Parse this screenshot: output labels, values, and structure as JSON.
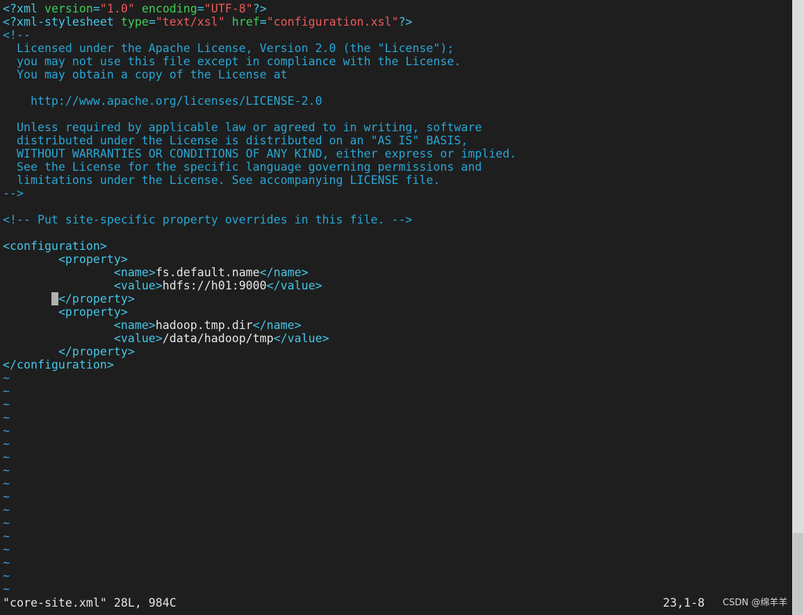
{
  "editor": {
    "lines": [
      [
        {
          "t": "<?",
          "c": "tag"
        },
        {
          "t": "xml ",
          "c": "tag"
        },
        {
          "t": "version",
          "c": "attr"
        },
        {
          "t": "=",
          "c": "tag"
        },
        {
          "t": "\"1.0\"",
          "c": "str"
        },
        {
          "t": " ",
          "c": "tag"
        },
        {
          "t": "encoding",
          "c": "attr"
        },
        {
          "t": "=",
          "c": "tag"
        },
        {
          "t": "\"UTF-8\"",
          "c": "str"
        },
        {
          "t": "?>",
          "c": "tag"
        }
      ],
      [
        {
          "t": "<?",
          "c": "tag"
        },
        {
          "t": "xml-stylesheet ",
          "c": "tag"
        },
        {
          "t": "type",
          "c": "attr"
        },
        {
          "t": "=",
          "c": "tag"
        },
        {
          "t": "\"text/xsl\"",
          "c": "str"
        },
        {
          "t": " ",
          "c": "tag"
        },
        {
          "t": "href",
          "c": "attr"
        },
        {
          "t": "=",
          "c": "tag"
        },
        {
          "t": "\"configuration.xsl\"",
          "c": "str"
        },
        {
          "t": "?>",
          "c": "tag"
        }
      ],
      [
        {
          "t": "<!--",
          "c": "comment"
        }
      ],
      [
        {
          "t": "  Licensed under the Apache License, Version 2.0 (the \"License\");",
          "c": "comment"
        }
      ],
      [
        {
          "t": "  you may not use this file except in compliance with the License.",
          "c": "comment"
        }
      ],
      [
        {
          "t": "  You may obtain a copy of the License at",
          "c": "comment"
        }
      ],
      [],
      [
        {
          "t": "    http://www.apache.org/licenses/LICENSE-2.0",
          "c": "comment"
        }
      ],
      [],
      [
        {
          "t": "  Unless required by applicable law or agreed to in writing, software",
          "c": "comment"
        }
      ],
      [
        {
          "t": "  distributed under the License is distributed on an \"AS IS\" BASIS,",
          "c": "comment"
        }
      ],
      [
        {
          "t": "  WITHOUT WARRANTIES OR CONDITIONS OF ANY KIND, either express or implied.",
          "c": "comment"
        }
      ],
      [
        {
          "t": "  See the License for the specific language governing permissions and",
          "c": "comment"
        }
      ],
      [
        {
          "t": "  limitations under the License. See accompanying LICENSE file.",
          "c": "comment"
        }
      ],
      [
        {
          "t": "-->",
          "c": "comment"
        }
      ],
      [],
      [
        {
          "t": "<!-- Put site-specific property overrides in this file. -->",
          "c": "comment"
        }
      ],
      [],
      [
        {
          "t": "<configuration>",
          "c": "tag"
        }
      ],
      [
        {
          "t": "        ",
          "c": "text"
        },
        {
          "t": "<property>",
          "c": "tag"
        }
      ],
      [
        {
          "t": "                ",
          "c": "text"
        },
        {
          "t": "<name>",
          "c": "tag"
        },
        {
          "t": "fs.default.name",
          "c": "text"
        },
        {
          "t": "</name>",
          "c": "tag"
        }
      ],
      [
        {
          "t": "                ",
          "c": "text"
        },
        {
          "t": "<value>",
          "c": "tag"
        },
        {
          "t": "hdfs://h01:9000",
          "c": "text"
        },
        {
          "t": "</value>",
          "c": "tag"
        }
      ],
      [
        {
          "t": "       ",
          "c": "text"
        },
        {
          "t": " ",
          "c": "cursor"
        },
        {
          "t": "</property>",
          "c": "tag"
        }
      ],
      [
        {
          "t": "        ",
          "c": "text"
        },
        {
          "t": "<property>",
          "c": "tag"
        }
      ],
      [
        {
          "t": "                ",
          "c": "text"
        },
        {
          "t": "<name>",
          "c": "tag"
        },
        {
          "t": "hadoop.tmp.dir",
          "c": "text"
        },
        {
          "t": "</name>",
          "c": "tag"
        }
      ],
      [
        {
          "t": "                ",
          "c": "text"
        },
        {
          "t": "<value>",
          "c": "tag"
        },
        {
          "t": "/data/hadoop/tmp",
          "c": "text"
        },
        {
          "t": "</value>",
          "c": "tag"
        }
      ],
      [
        {
          "t": "        ",
          "c": "text"
        },
        {
          "t": "</property>",
          "c": "tag"
        }
      ],
      [
        {
          "t": "</configuration>",
          "c": "tag"
        }
      ],
      [
        {
          "t": "~",
          "c": "tilde"
        }
      ],
      [
        {
          "t": "~",
          "c": "tilde"
        }
      ],
      [
        {
          "t": "~",
          "c": "tilde"
        }
      ],
      [
        {
          "t": "~",
          "c": "tilde"
        }
      ],
      [
        {
          "t": "~",
          "c": "tilde"
        }
      ],
      [
        {
          "t": "~",
          "c": "tilde"
        }
      ],
      [
        {
          "t": "~",
          "c": "tilde"
        }
      ],
      [
        {
          "t": "~",
          "c": "tilde"
        }
      ],
      [
        {
          "t": "~",
          "c": "tilde"
        }
      ],
      [
        {
          "t": "~",
          "c": "tilde"
        }
      ],
      [
        {
          "t": "~",
          "c": "tilde"
        }
      ],
      [
        {
          "t": "~",
          "c": "tilde"
        }
      ],
      [
        {
          "t": "~",
          "c": "tilde"
        }
      ],
      [
        {
          "t": "~",
          "c": "tilde"
        }
      ],
      [
        {
          "t": "~",
          "c": "tilde"
        }
      ],
      [
        {
          "t": "~",
          "c": "tilde"
        }
      ],
      [
        {
          "t": "~",
          "c": "tilde"
        }
      ]
    ]
  },
  "status": {
    "file_info": "\"core-site.xml\" 28L, 984C",
    "cursor_position": "23,1-8"
  },
  "watermark": "CSDN @绵羊羊",
  "colors": {
    "background": "#1e1e1e",
    "comment": "#28a7d6",
    "tag": "#45c7e8",
    "attribute": "#3fcf58",
    "string": "#ee5a5a",
    "text": "#e6e6e6",
    "tilde": "#3aa0e6",
    "cursor": "#b0b0b0"
  }
}
